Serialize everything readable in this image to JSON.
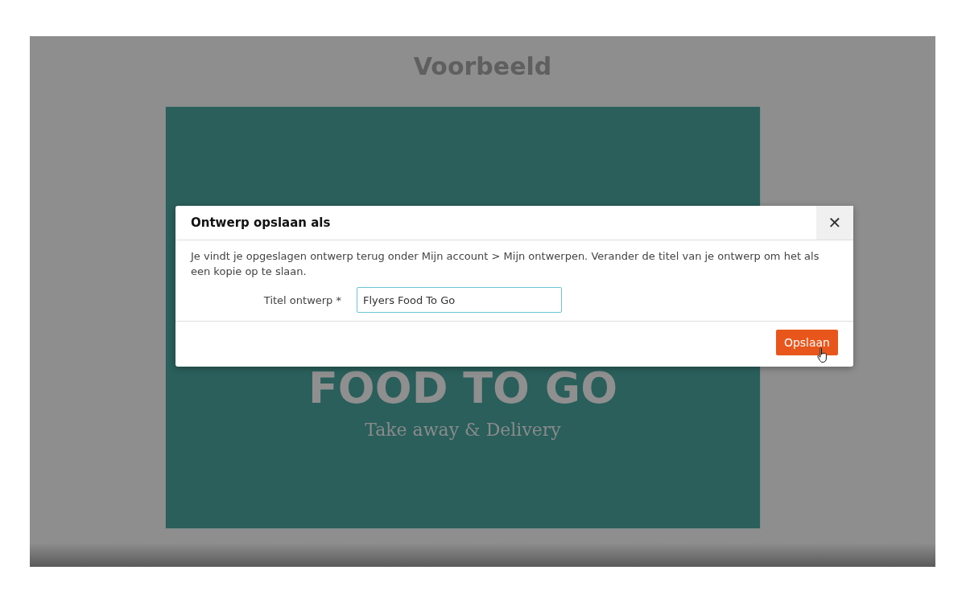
{
  "page": {
    "title": "Voorbeeld"
  },
  "flyer": {
    "headline": "FOOD TO GO",
    "tagline": "Take away & Delivery"
  },
  "dialog": {
    "title": "Ontwerp opslaan als",
    "close": "✕",
    "message": "Je vindt je opgeslagen ontwerp terug onder Mijn account > Mijn ontwerpen. Verander de titel van je ontwerp om het als een kopie op te slaan.",
    "field": {
      "label": "Titel ontwerp *",
      "value": "Flyers Food To Go"
    },
    "buttons": [
      "Opslaan"
    ]
  }
}
